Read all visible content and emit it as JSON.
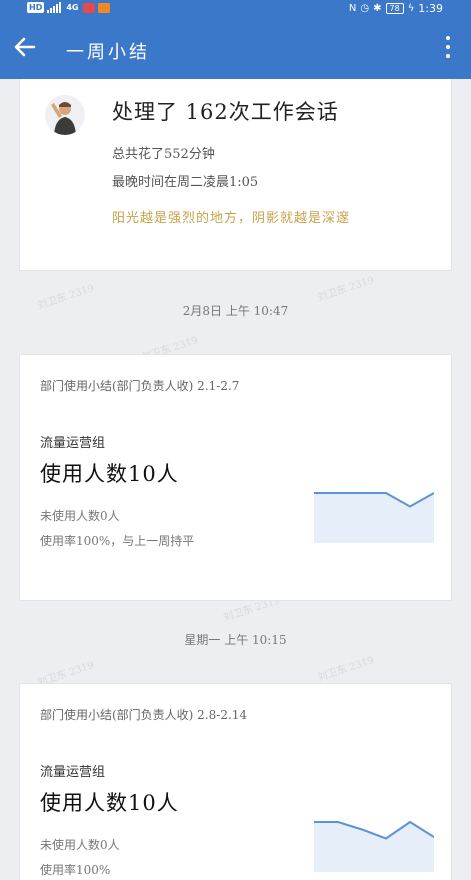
{
  "status_bar": {
    "left_badges": [
      "HD",
      "4G"
    ],
    "battery": "78",
    "time": "1:39"
  },
  "header": {
    "title": "一周小结"
  },
  "summary_card": {
    "title": "处理了 162次工作会话",
    "line1": "总共花了552分钟",
    "line2": "最晚时间在周二凌晨1:05",
    "quote": "阳光越是强烈的地方，阴影就越是深邃"
  },
  "timestamps": [
    "2月8日  上午 10:47",
    "星期一  上午 10:15"
  ],
  "watermark": "刘卫东 2319",
  "report_cards": [
    {
      "header": "部门使用小结(部门负责人收) 2.1-2.7",
      "group": "流量运营组",
      "users": "使用人数10人",
      "unused": "未使用人数0人",
      "rate": "使用率100%，与上一周持平",
      "trend": [
        1,
        1,
        1,
        1,
        0.55,
        1
      ]
    },
    {
      "header": "部门使用小结(部门负责人收) 2.8-2.14",
      "group": "流量运营组",
      "users": "使用人数10人",
      "unused": "未使用人数0人",
      "rate": "使用率100%",
      "trend": [
        1,
        1,
        0.75,
        0.45,
        1,
        0.5
      ]
    }
  ],
  "colors": {
    "accent": "#3b78c9",
    "quote": "#c9a24a",
    "line": "#5b93d6",
    "area": "#e6eef9"
  }
}
